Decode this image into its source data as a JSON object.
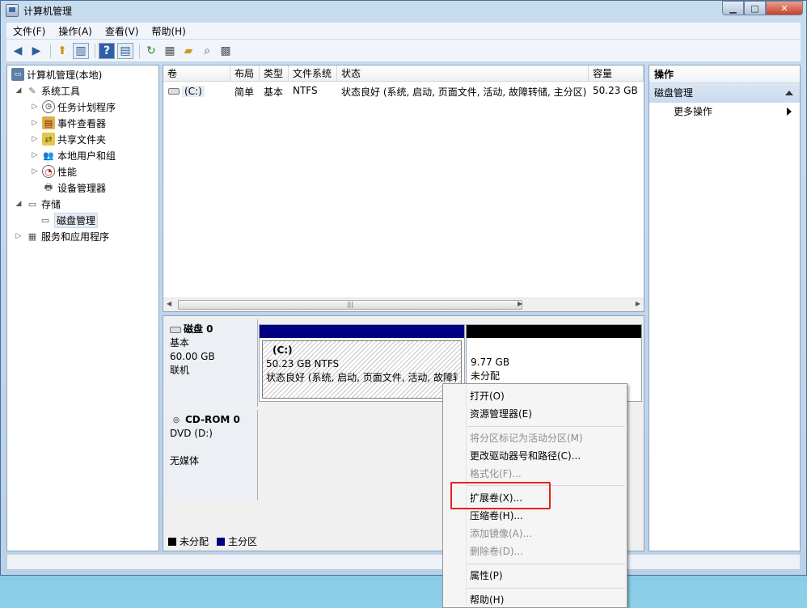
{
  "window": {
    "title": "计算机管理"
  },
  "menu": [
    "文件(F)",
    "操作(A)",
    "查看(V)",
    "帮助(H)"
  ],
  "tree": {
    "root": "计算机管理(本地)",
    "system_tools": "系统工具",
    "task_scheduler": "任务计划程序",
    "event_viewer": "事件查看器",
    "shared_folders": "共享文件夹",
    "local_users": "本地用户和组",
    "performance": "性能",
    "device_manager": "设备管理器",
    "storage": "存储",
    "disk_management": "磁盘管理",
    "services": "服务和应用程序"
  },
  "list": {
    "columns": [
      "卷",
      "布局",
      "类型",
      "文件系统",
      "状态",
      "容量"
    ],
    "row": {
      "volume": "(C:)",
      "layout": "简单",
      "type": "基本",
      "fs": "NTFS",
      "status": "状态良好 (系统, 启动, 页面文件, 活动, 故障转储, 主分区)",
      "capacity": "50.23 GB"
    }
  },
  "disks": {
    "disk0": {
      "name": "磁盘 0",
      "type": "基本",
      "size": "60.00 GB",
      "state": "联机"
    },
    "c_part": {
      "label": "(C:)",
      "size": "50.23 GB NTFS",
      "status": "状态良好 (系统, 启动, 页面文件, 活动, 故障转"
    },
    "unalloc": {
      "size": "9.77 GB",
      "label": "未分配"
    },
    "cdrom": {
      "name": "CD-ROM 0",
      "drive": "DVD (D:)",
      "media": "无媒体"
    }
  },
  "legend": {
    "unallocated": "未分配",
    "primary": "主分区"
  },
  "actions": {
    "header": "操作",
    "section": "磁盘管理",
    "more": "更多操作"
  },
  "context_menu": {
    "open": "打开(O)",
    "explorer": "资源管理器(E)",
    "mark_active": "将分区标记为活动分区(M)",
    "change_letter": "更改驱动器号和路径(C)...",
    "format": "格式化(F)...",
    "extend": "扩展卷(X)...",
    "shrink": "压缩卷(H)...",
    "mirror": "添加镜像(A)...",
    "delete": "删除卷(D)...",
    "properties": "属性(P)",
    "help": "帮助(H)"
  },
  "colors": {
    "primary_partition": "#000080",
    "unallocated": "#000000",
    "highlight": "#e8201a"
  }
}
